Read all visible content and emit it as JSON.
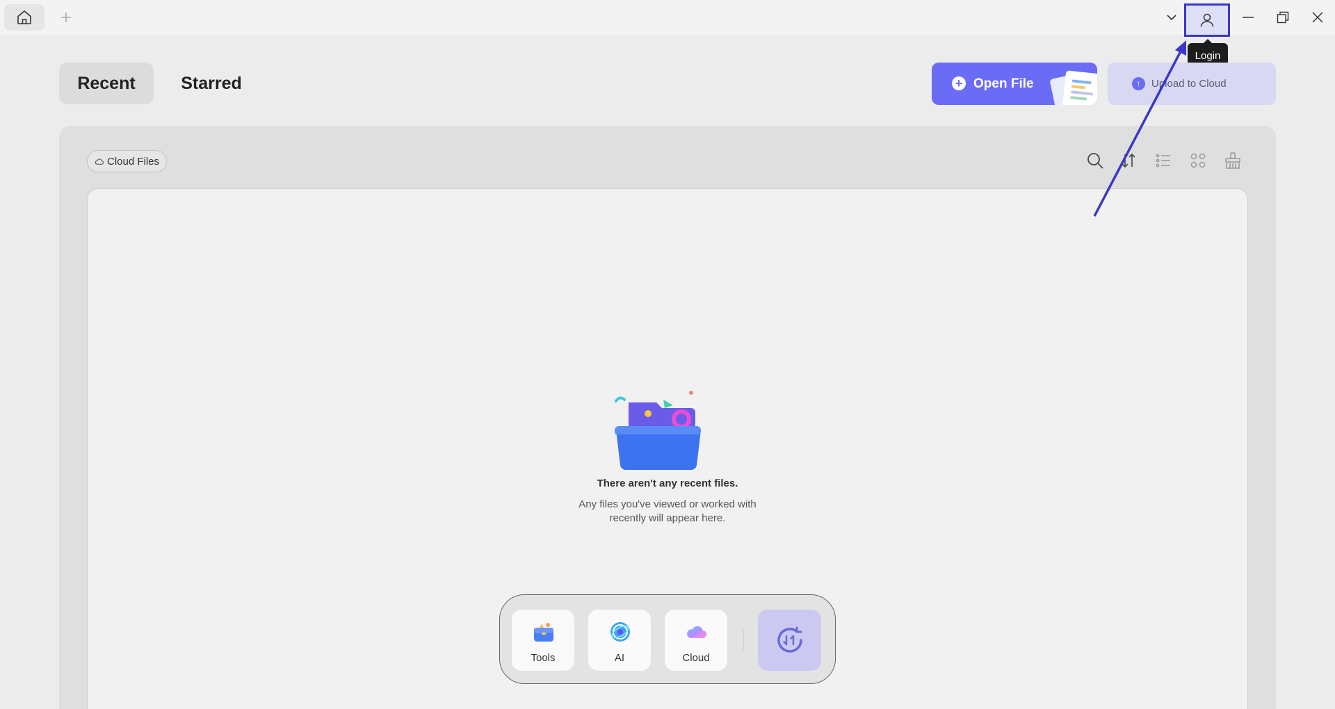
{
  "titlebar": {
    "login_tooltip": "Login"
  },
  "tabs": {
    "recent": "Recent",
    "starred": "Starred"
  },
  "actions": {
    "open_file": "Open File",
    "upload_to_cloud": "Upload to Cloud"
  },
  "panel": {
    "cloud_files": "Cloud Files",
    "empty_title": "There aren't any recent files.",
    "empty_desc_line1": "Any files you've viewed or worked with",
    "empty_desc_line2": "recently will appear here."
  },
  "dock": {
    "tools": "Tools",
    "ai": "AI",
    "cloud": "Cloud"
  },
  "colors": {
    "accent": "#6a6cf6",
    "highlight_border": "#3b36c9",
    "annotation_arrow": "#3b36c9"
  }
}
